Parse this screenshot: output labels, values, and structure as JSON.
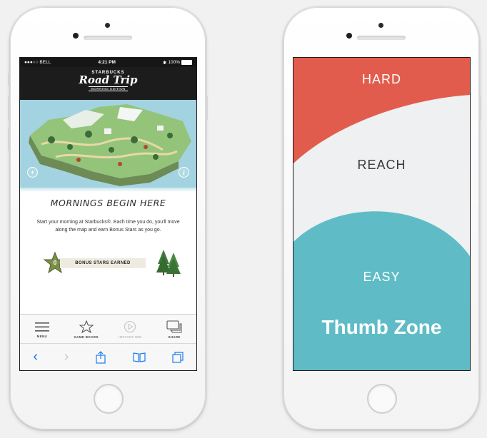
{
  "left_phone": {
    "status": {
      "carrier": "●●●○○ BELL",
      "time": "4:21 PM",
      "battery": "100%"
    },
    "header": {
      "brand": "STARBUCKS",
      "title": "Road Trip",
      "edition": "MORNING EDITION"
    },
    "map": {
      "zoom_icon": "zoom-in-icon",
      "info_icon": "info-icon"
    },
    "headline": "MORNINGS BEGIN HERE",
    "body": "Start your morning at Starbucks®. Each time you do, you'll move along the map and earn Bonus Stars as you go.",
    "bonus": {
      "count": "0",
      "label": "BONUS STARS EARNED"
    },
    "tabs": [
      {
        "label": "MENU",
        "icon": "menu-icon"
      },
      {
        "label": "GAME BOARD",
        "icon": "star-icon"
      },
      {
        "label": "INSTANT WIN",
        "icon": "play-icon"
      },
      {
        "label": "SHARE",
        "icon": "chat-icon"
      }
    ],
    "safari": {
      "back": "‹",
      "forward": "›"
    }
  },
  "right_phone": {
    "hard": "HARD",
    "reach": "REACH",
    "easy": "EASY",
    "title": "Thumb Zone",
    "colors": {
      "hard": "#e25c4e",
      "reach": "#eff0f1",
      "easy": "#5fbcc6"
    }
  }
}
